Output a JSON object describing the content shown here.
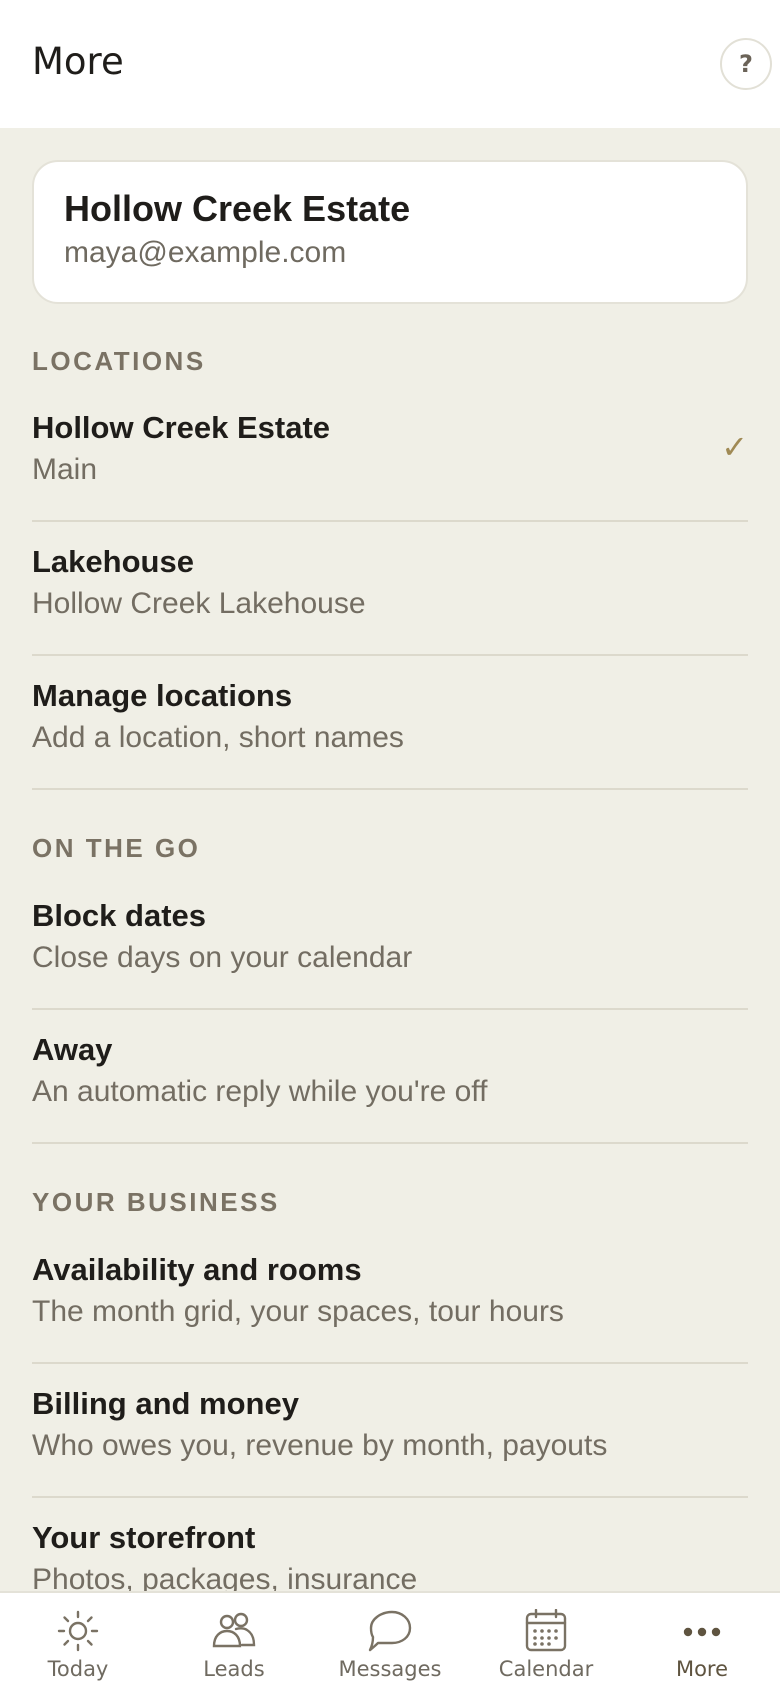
{
  "header": {
    "title": "More",
    "help_label": "?"
  },
  "account": {
    "name": "Hollow Creek Estate",
    "email": "maya@example.com"
  },
  "sections": [
    {
      "label": "LOCATIONS",
      "items": [
        {
          "title": "Hollow Creek Estate",
          "subtitle": "Main",
          "selected": true
        },
        {
          "title": "Lakehouse",
          "subtitle": "Hollow Creek Lakehouse"
        },
        {
          "title": "Manage locations",
          "subtitle": "Add a location, short names"
        }
      ]
    },
    {
      "label": "ON THE GO",
      "items": [
        {
          "title": "Block dates",
          "subtitle": "Close days on your calendar"
        },
        {
          "title": "Away",
          "subtitle": "An automatic reply while you're off"
        }
      ]
    },
    {
      "label": "YOUR BUSINESS",
      "items": [
        {
          "title": "Availability and rooms",
          "subtitle": "The month grid, your spaces, tour hours"
        },
        {
          "title": "Billing and money",
          "subtitle": "Who owes you, revenue by month, payouts"
        },
        {
          "title": "Your storefront",
          "subtitle": "Photos, packages, insurance"
        }
      ]
    }
  ],
  "check_glyph": "✓",
  "tabs": [
    {
      "label": "Today",
      "icon": "sun-icon"
    },
    {
      "label": "Leads",
      "icon": "people-icon"
    },
    {
      "label": "Messages",
      "icon": "chat-bubble-icon"
    },
    {
      "label": "Calendar",
      "icon": "calendar-icon"
    },
    {
      "label": "More",
      "icon": "more-dots-icon",
      "active": true
    }
  ],
  "colors": {
    "background": "#f0efe6",
    "accent": "#a08a55",
    "active_tab": "#5f5440"
  }
}
